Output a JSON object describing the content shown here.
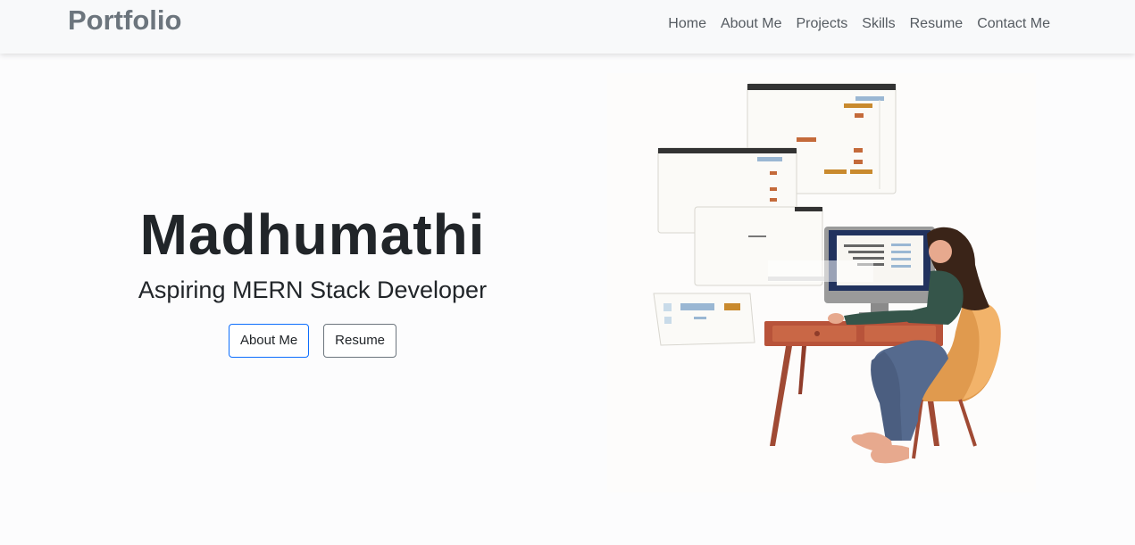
{
  "navbar": {
    "brand": "Portfolio",
    "links": [
      "Home",
      "About Me",
      "Projects",
      "Skills",
      "Resume",
      "Contact Me"
    ]
  },
  "hero": {
    "name": "Madhumathi",
    "role": "Aspiring MERN Stack Developer",
    "buttons": {
      "about": "About Me",
      "resume": "Resume"
    }
  },
  "colors": {
    "navbar_bg": "#f8f9fa",
    "brand": "#6c757d",
    "primary_outline": "#0d6efd",
    "text": "#212529"
  },
  "illustration": {
    "icon": "developer-at-desk-illustration"
  }
}
